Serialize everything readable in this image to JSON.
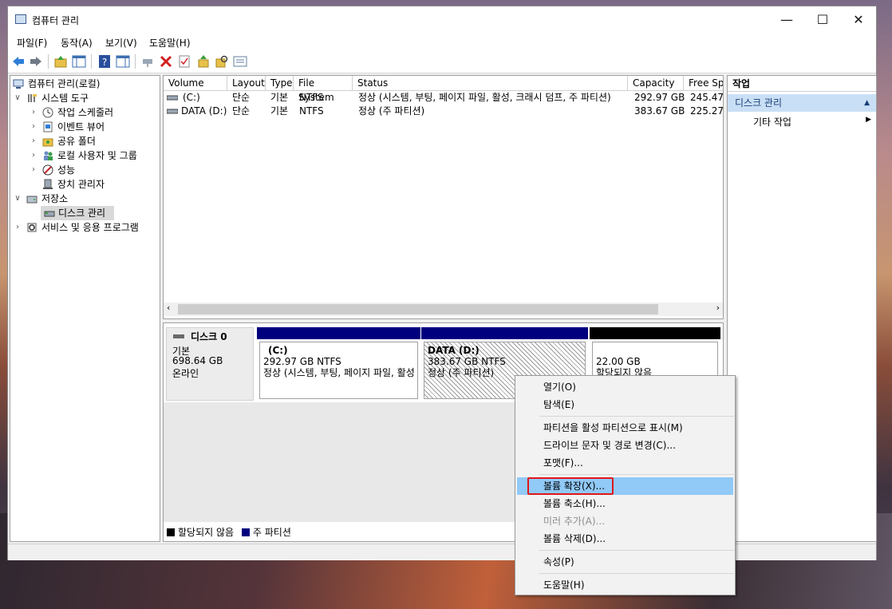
{
  "window": {
    "title": "컴퓨터 관리",
    "controls": {
      "minimize": "—",
      "maximize": "☐",
      "close": "✕"
    }
  },
  "menubar": {
    "items": [
      {
        "label": "파일(F)"
      },
      {
        "label": "동작(A)"
      },
      {
        "label": "보기(V)"
      },
      {
        "label": "도움말(H)"
      }
    ]
  },
  "toolbar": {
    "icons": [
      "back-arrow-icon",
      "forward-arrow-icon",
      "up-folder-icon",
      "show-hide-tree-icon",
      "help-icon",
      "show-hide-action-icon",
      "connect-icon",
      "delete-icon",
      "properties-icon",
      "import-icon",
      "search-icon",
      "export-list-icon"
    ]
  },
  "tree": {
    "root": "컴퓨터 관리(로컬)",
    "items": [
      {
        "label": "시스템 도구"
      },
      {
        "label": "작업 스케줄러"
      },
      {
        "label": "이벤트 뷰어"
      },
      {
        "label": "공유 폴더"
      },
      {
        "label": "로컬 사용자 및 그룹"
      },
      {
        "label": "성능"
      },
      {
        "label": "장치 관리자"
      },
      {
        "label": "저장소"
      },
      {
        "label": "디스크 관리"
      },
      {
        "label": "서비스 및 응용 프로그램"
      }
    ]
  },
  "volumes": {
    "columns": [
      "Volume",
      "Layout",
      "Type",
      "File System",
      "Status",
      "Capacity",
      "Free Sp"
    ],
    "rows": [
      {
        "volume": "(C:)",
        "layout": "단순",
        "type": "기본",
        "fs": "NTFS",
        "status": "정상 (시스템, 부팅, 페이지 파일, 활성, 크래시 덤프, 주 파티션)",
        "capacity": "292.97 GB",
        "free": "245.47"
      },
      {
        "volume": "DATA (D:)",
        "layout": "단순",
        "type": "기본",
        "fs": "NTFS",
        "status": "정상 (주 파티션)",
        "capacity": "383.67 GB",
        "free": "225.27"
      }
    ]
  },
  "disk": {
    "name": "디스크 0",
    "kind": "기본",
    "size": "698.64 GB",
    "state": "온라인",
    "partitions": [
      {
        "title": "(C:)",
        "size": "292.97 GB NTFS",
        "status": "정상 (시스템, 부팅, 페이지 파일, 활성"
      },
      {
        "title": "DATA  (D:)",
        "size": "383.67 GB NTFS",
        "status": "정상 (주 파티션)"
      },
      {
        "title": "",
        "size": "22.00 GB",
        "status": "할당되지 않음"
      }
    ]
  },
  "legend": {
    "unallocated": "할당되지 않음",
    "primary": "주 파티션"
  },
  "actions": {
    "header": "작업",
    "section": "디스크 관리",
    "item": "기타 작업"
  },
  "context_menu": {
    "items": {
      "open": "열기(O)",
      "explore": "탐색(E)",
      "mark_active": "파티션을 활성 파티션으로 표시(M)",
      "change_letter": "드라이브 문자 및 경로 변경(C)...",
      "format": "포맷(F)...",
      "extend": "볼륨 확장(X)...",
      "shrink": "볼륨 축소(H)...",
      "add_mirror": "미러 추가(A)...",
      "delete": "볼륨 삭제(D)...",
      "properties": "속성(P)",
      "help": "도움말(H)"
    }
  },
  "colors": {
    "primary_partition": "#00007f",
    "unallocated": "#000000",
    "menu_highlight": "#91c9f7",
    "callout": "#e0161b"
  }
}
